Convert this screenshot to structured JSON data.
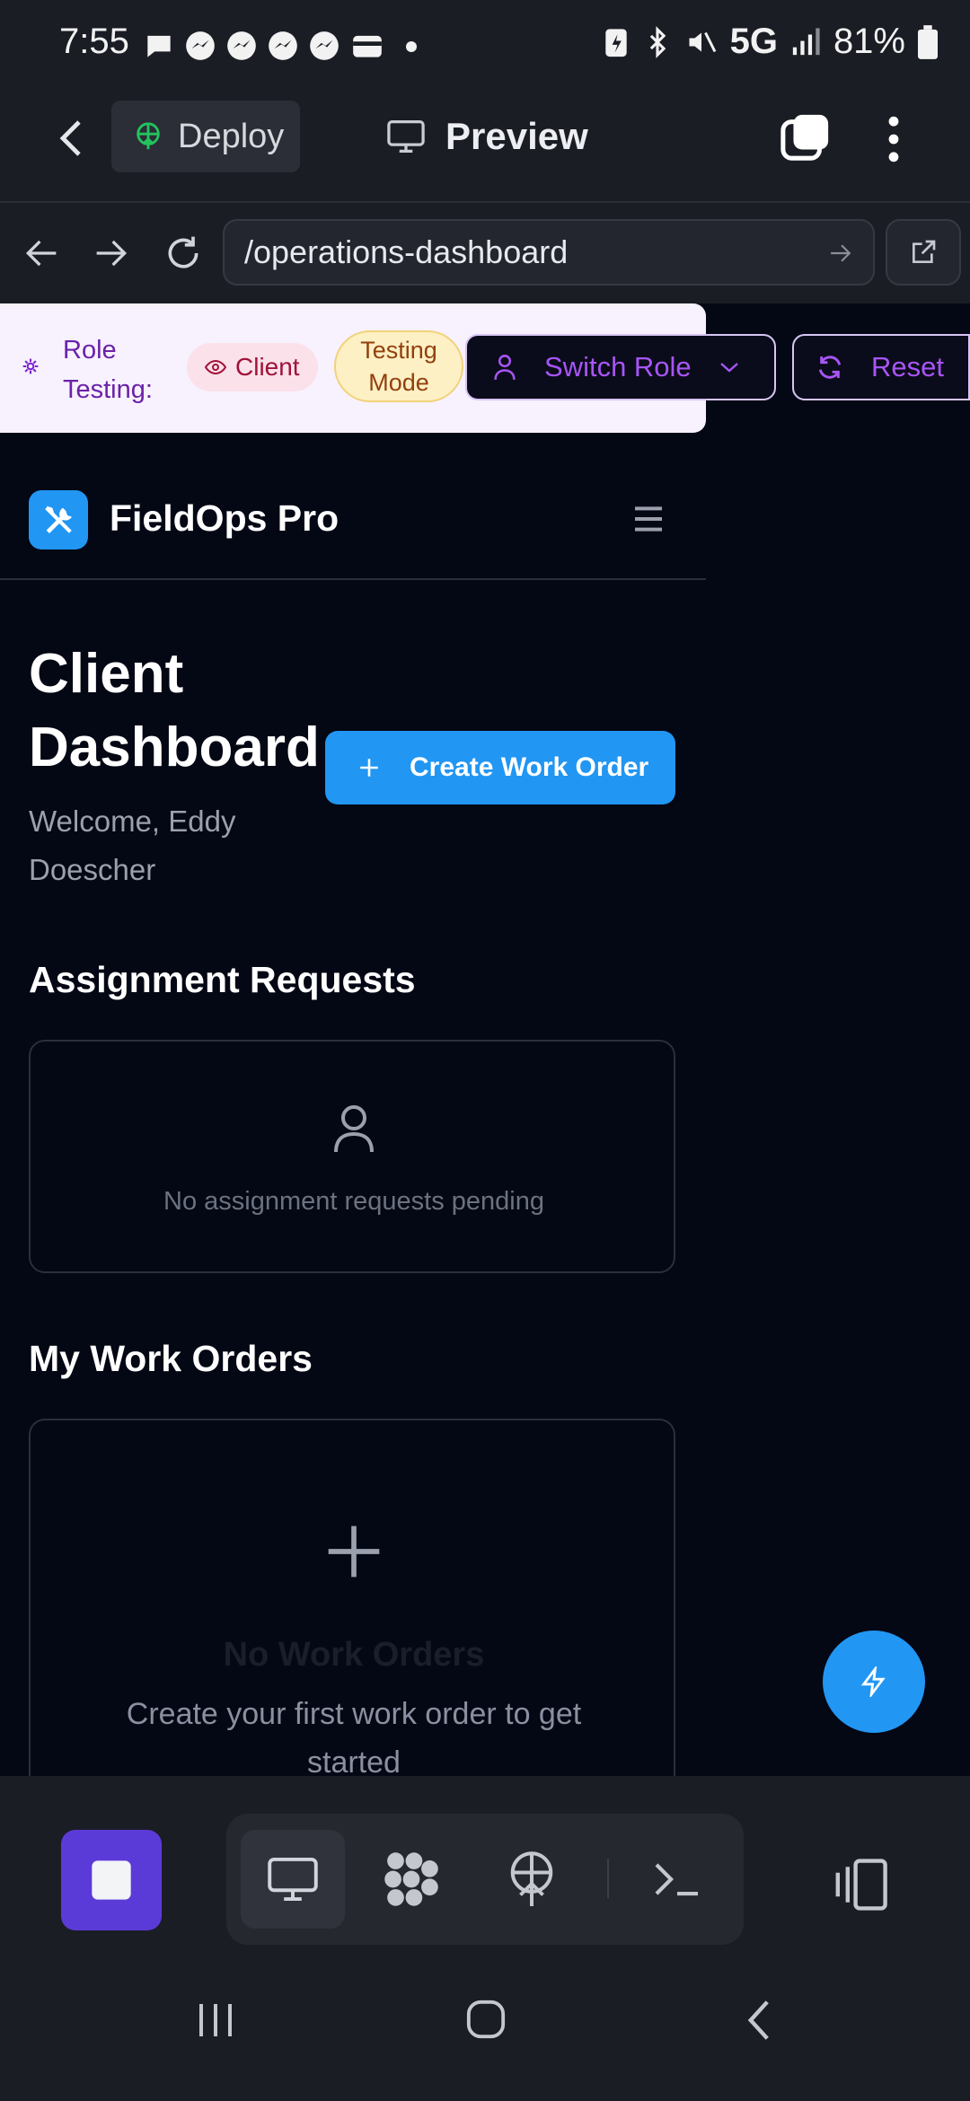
{
  "status_bar": {
    "time": "7:55",
    "network": "5G",
    "battery": "81%"
  },
  "top_bar": {
    "deploy_label": "Deploy",
    "preview_label": "Preview"
  },
  "url_bar": {
    "value": "/operations-dashboard"
  },
  "role_banner": {
    "label": "Role Testing:",
    "role": "Client",
    "mode": "Testing Mode",
    "switch_label": "Switch Role",
    "reset_label": "Reset"
  },
  "app": {
    "name": "FieldOps Pro",
    "page_title": "Client Dashboard",
    "welcome": "Welcome, Eddy Doescher",
    "create_label": "Create Work Order",
    "assignment_title": "Assignment Requests",
    "assignment_empty": "No assignment requests pending",
    "orders_title": "My Work Orders",
    "orders_empty_title": "No Work Orders",
    "orders_empty_sub": "Create your first work order to get started"
  },
  "colors": {
    "accent": "#2196f3",
    "purple": "#a855f7",
    "background": "#040714"
  }
}
